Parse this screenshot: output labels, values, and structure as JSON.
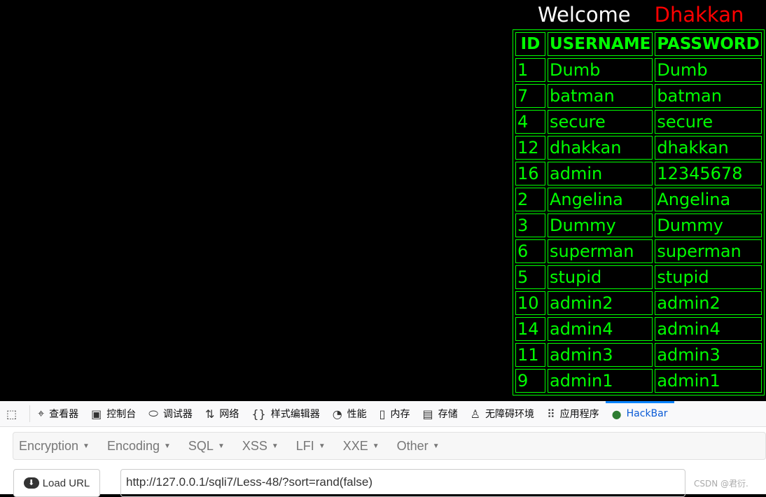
{
  "welcome": {
    "label": "Welcome",
    "name": "Dhakkan"
  },
  "table": {
    "headers": [
      "ID",
      "USERNAME",
      "PASSWORD"
    ],
    "rows": [
      [
        "1",
        "Dumb",
        "Dumb"
      ],
      [
        "7",
        "batman",
        "batman"
      ],
      [
        "4",
        "secure",
        "secure"
      ],
      [
        "12",
        "dhakkan",
        "dhakkan"
      ],
      [
        "16",
        "admin",
        "12345678"
      ],
      [
        "2",
        "Angelina",
        "Angelina"
      ],
      [
        "3",
        "Dummy",
        "Dummy"
      ],
      [
        "6",
        "superman",
        "superman"
      ],
      [
        "5",
        "stupid",
        "stupid"
      ],
      [
        "10",
        "admin2",
        "admin2"
      ],
      [
        "14",
        "admin4",
        "admin4"
      ],
      [
        "11",
        "admin3",
        "admin3"
      ],
      [
        "9",
        "admin1",
        "admin1"
      ]
    ]
  },
  "devtools": {
    "tabs": [
      {
        "label": "查看器",
        "icon": "inspector-icon"
      },
      {
        "label": "控制台",
        "icon": "console-icon"
      },
      {
        "label": "调试器",
        "icon": "debugger-icon"
      },
      {
        "label": "网络",
        "icon": "network-icon"
      },
      {
        "label": "样式编辑器",
        "icon": "style-editor-icon"
      },
      {
        "label": "性能",
        "icon": "performance-icon"
      },
      {
        "label": "内存",
        "icon": "memory-icon"
      },
      {
        "label": "存储",
        "icon": "storage-icon"
      },
      {
        "label": "无障碍环境",
        "icon": "accessibility-icon"
      },
      {
        "label": "应用程序",
        "icon": "application-icon"
      },
      {
        "label": "HackBar",
        "icon": "hackbar-icon",
        "selected": true
      }
    ],
    "accent": "#0a84ff"
  },
  "hackbar": {
    "menus": [
      "Encryption",
      "Encoding",
      "SQL",
      "XSS",
      "LFI",
      "XXE",
      "Other"
    ],
    "load_url": "Load URL",
    "url": "http://127.0.0.1/sqli7/Less-48/?sort=rand(false)"
  },
  "watermark": "CSDN @君衍."
}
